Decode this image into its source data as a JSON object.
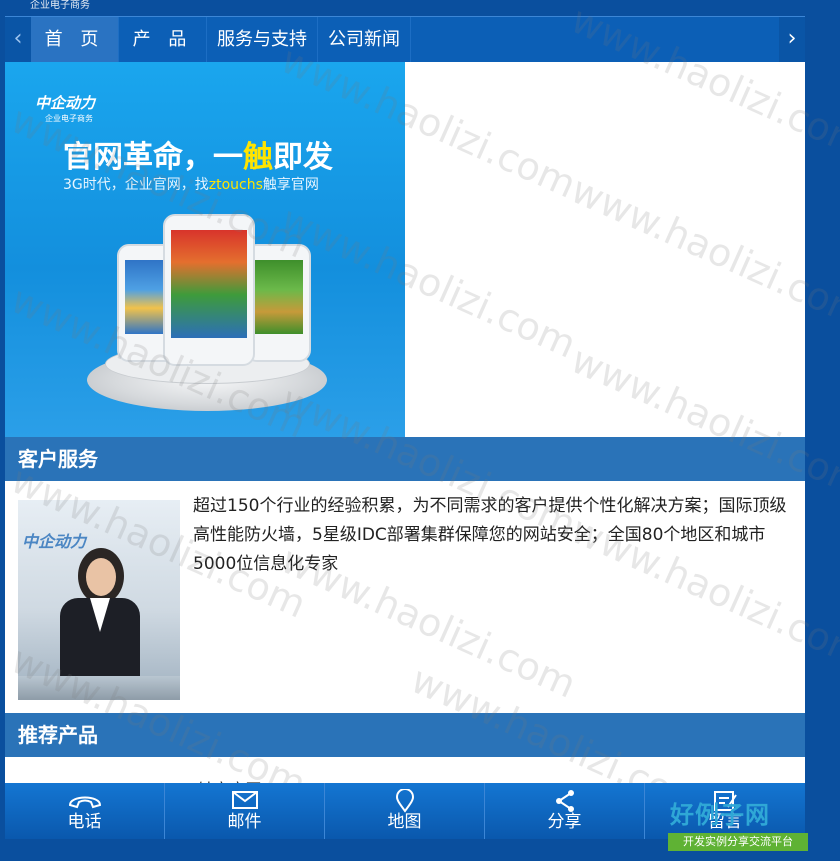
{
  "brand": {
    "top_text": "企业电子商务"
  },
  "nav": {
    "prev_arrow": "‹",
    "next_arrow": "›",
    "items": [
      {
        "label": "首 页",
        "active": true
      },
      {
        "label": "产 品"
      },
      {
        "label": "服务与支持"
      },
      {
        "label": "公司新闻"
      }
    ]
  },
  "banner": {
    "logo": "中企动力",
    "logo_sub": "企业电子商务",
    "title_pre": "官网革命，一",
    "title_hl": "触",
    "title_post": "即发",
    "subtitle_pre": "3G时代，企业官网，找",
    "subtitle_hl": "ztouchs",
    "subtitle_post": "触享官网"
  },
  "customer_service": {
    "heading": "客户服务",
    "photo_logo": "中企动力",
    "text": "超过150个行业的经验积累，为不同需求的客户提供个性化解决方案；国际顶级高性能防火墙，5星级IDC部署集群保障您的网站安全；全国80个地区和城市5000位信息化专家"
  },
  "recommended": {
    "heading": "推荐产品",
    "first_item": "Ztouchs触享官网"
  },
  "bottom_nav": [
    {
      "label": "电话",
      "icon": "phone-icon"
    },
    {
      "label": "邮件",
      "icon": "mail-icon"
    },
    {
      "label": "地图",
      "icon": "map-pin-icon"
    },
    {
      "label": "分享",
      "icon": "share-icon"
    },
    {
      "label": "留言",
      "icon": "message-icon"
    }
  ],
  "watermark": "www.haolizi.com",
  "corner_badge": {
    "title": "好例子网",
    "subtitle": "开发实例分享交流平台"
  },
  "colors": {
    "nav_bg": "#0c5fb6",
    "section_bar": "#2a73b8",
    "page_bg": "#0a4f9e",
    "badge_green": "#5fb234"
  }
}
